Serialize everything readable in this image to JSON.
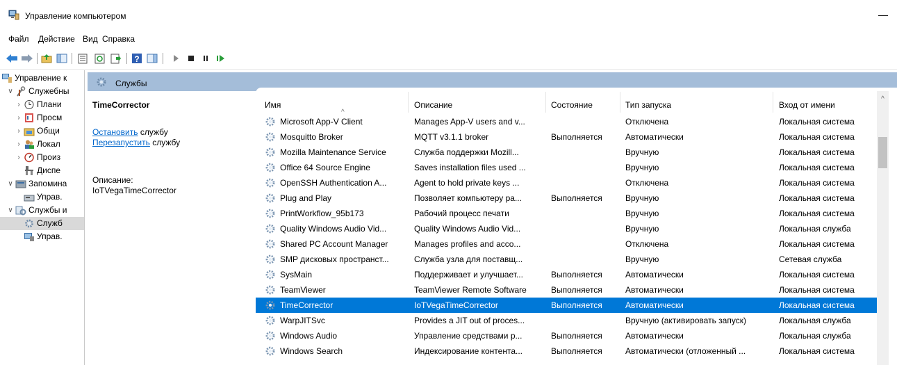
{
  "window": {
    "title": "Управление компьютером",
    "minimize_glyph": "—"
  },
  "menu": [
    "Файл",
    "Действие",
    "Вид",
    "Справка"
  ],
  "toolbar": {
    "icons": [
      "back-arrow-icon",
      "forward-arrow-icon",
      "up-folder-icon",
      "show-hide-tree-icon",
      "properties-icon",
      "refresh-icon",
      "export-list-icon",
      "help-icon",
      "show-hide-action-pane-icon",
      "start-service-icon",
      "stop-service-icon",
      "pause-service-icon",
      "resume-service-icon"
    ]
  },
  "tree": [
    {
      "label": "Управление к",
      "expander": "",
      "icon": "computer-management-icon",
      "level": 0
    },
    {
      "label": "Служебны",
      "expander": "∨",
      "icon": "tools-icon",
      "level": 1
    },
    {
      "label": "Плани",
      "expander": "›",
      "icon": "task-scheduler-icon",
      "level": 2
    },
    {
      "label": "Просм",
      "expander": "›",
      "icon": "event-viewer-icon",
      "level": 2
    },
    {
      "label": "Общи",
      "expander": "›",
      "icon": "shared-folders-icon",
      "level": 2
    },
    {
      "label": "Локал",
      "expander": "›",
      "icon": "local-users-icon",
      "level": 2
    },
    {
      "label": "Произ",
      "expander": "›",
      "icon": "performance-icon",
      "level": 2
    },
    {
      "label": "Диспе",
      "expander": "",
      "icon": "device-manager-icon",
      "level": 2
    },
    {
      "label": "Запомина",
      "expander": "∨",
      "icon": "storage-icon",
      "level": 1
    },
    {
      "label": "Управ.",
      "expander": "",
      "icon": "disk-management-icon",
      "level": 2
    },
    {
      "label": "Службы и",
      "expander": "∨",
      "icon": "services-apps-icon",
      "level": 1
    },
    {
      "label": "Служб",
      "expander": "",
      "icon": "services-gear-icon",
      "level": 2,
      "selected": true
    },
    {
      "label": "Управ.",
      "expander": "",
      "icon": "wmi-control-icon",
      "level": 2
    }
  ],
  "header": {
    "title": "Службы"
  },
  "description": {
    "service_name": "TimeCorrector",
    "stop_link": "Остановить",
    "stop_suffix": " службу",
    "restart_link": "Перезапустить",
    "restart_suffix": " службу",
    "desc_label": "Описание:",
    "desc_value": "IoTVegaTimeCorrector"
  },
  "columns": {
    "name": "Имя",
    "description": "Описание",
    "status": "Состояние",
    "startup": "Тип запуска",
    "logon": "Вход от имени",
    "sort_caret": "^"
  },
  "rows": [
    {
      "name": "Microsoft App-V Client",
      "description": "Manages App-V users and v...",
      "status": "",
      "startup": "Отключена",
      "logon": "Локальная система"
    },
    {
      "name": "Mosquitto Broker",
      "description": "MQTT v3.1.1 broker",
      "status": "Выполняется",
      "startup": "Автоматически",
      "logon": "Локальная система"
    },
    {
      "name": "Mozilla Maintenance Service",
      "description": "Служба поддержки Mozill...",
      "status": "",
      "startup": "Вручную",
      "logon": "Локальная система"
    },
    {
      "name": "Office 64 Source Engine",
      "description": "Saves installation files used ...",
      "status": "",
      "startup": "Вручную",
      "logon": "Локальная система"
    },
    {
      "name": "OpenSSH Authentication A...",
      "description": "Agent to hold private keys ...",
      "status": "",
      "startup": "Отключена",
      "logon": "Локальная система"
    },
    {
      "name": "Plug and Play",
      "description": "Позволяет компьютеру ра...",
      "status": "Выполняется",
      "startup": "Вручную",
      "logon": "Локальная система"
    },
    {
      "name": "PrintWorkflow_95b173",
      "description": "Рабочий процесс печати",
      "status": "",
      "startup": "Вручную",
      "logon": "Локальная система"
    },
    {
      "name": "Quality Windows Audio Vid...",
      "description": "Quality Windows Audio Vid...",
      "status": "",
      "startup": "Вручную",
      "logon": "Локальная служба"
    },
    {
      "name": "Shared PC Account Manager",
      "description": "Manages profiles and acco...",
      "status": "",
      "startup": "Отключена",
      "logon": "Локальная система"
    },
    {
      "name": "SMP дисковых пространст...",
      "description": "Служба узла для поставщ...",
      "status": "",
      "startup": "Вручную",
      "logon": "Сетевая служба"
    },
    {
      "name": "SysMain",
      "description": "Поддерживает и улучшает...",
      "status": "Выполняется",
      "startup": "Автоматически",
      "logon": "Локальная система"
    },
    {
      "name": "TeamViewer",
      "description": "TeamViewer Remote Software",
      "status": "Выполняется",
      "startup": "Автоматически",
      "logon": "Локальная система"
    },
    {
      "name": "TimeCorrector",
      "description": "IoTVegaTimeCorrector",
      "status": "Выполняется",
      "startup": "Автоматически",
      "logon": "Локальная система",
      "selected": true
    },
    {
      "name": "WarpJITSvc",
      "description": "Provides a JIT out of proces...",
      "status": "",
      "startup": "Вручную (активировать запуск)",
      "logon": "Локальная служба"
    },
    {
      "name": "Windows Audio",
      "description": "Управление средствами р...",
      "status": "Выполняется",
      "startup": "Автоматически",
      "logon": "Локальная служба"
    },
    {
      "name": "Windows Search",
      "description": "Индексирование контента...",
      "status": "Выполняется",
      "startup": "Автоматически (отложенный ...",
      "logon": "Локальная система"
    }
  ],
  "colors": {
    "selection": "#0078d7",
    "header_band": "#a4bdd9",
    "link": "#0066cc"
  }
}
